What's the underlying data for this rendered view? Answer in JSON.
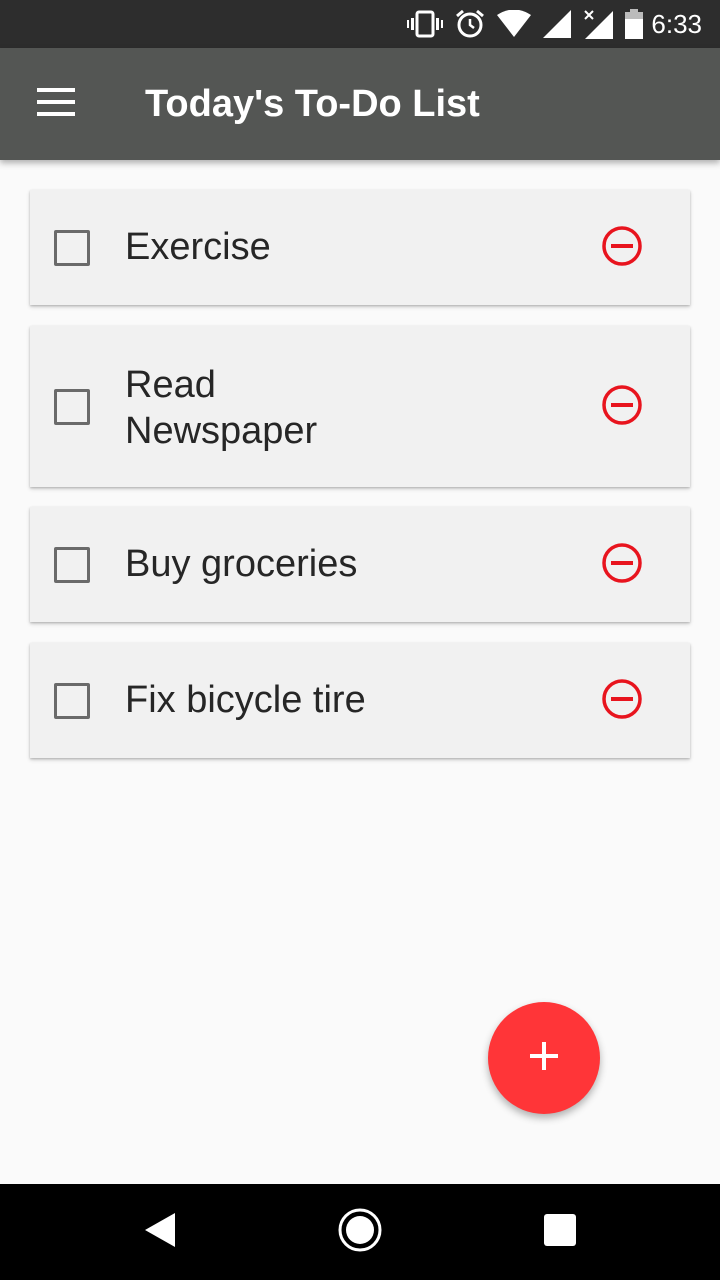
{
  "status_bar": {
    "time": "6:33",
    "icons": [
      "vibrate-icon",
      "alarm-icon",
      "wifi-icon",
      "cell-signal-icon",
      "cell-no-data-icon",
      "battery-icon"
    ]
  },
  "app_bar": {
    "title": "Today's To-Do List",
    "menu_icon": "hamburger-menu-icon"
  },
  "tasks": [
    {
      "label": "Exercise",
      "checked": false
    },
    {
      "label": "Read Newspaper",
      "checked": false
    },
    {
      "label": "Buy groceries",
      "checked": false
    },
    {
      "label": "Fix bicycle tire",
      "checked": false
    }
  ],
  "fab": {
    "icon": "plus-icon"
  },
  "nav_bar": {
    "icons": [
      "back-icon",
      "home-icon",
      "recents-icon"
    ]
  },
  "colors": {
    "app_bar": "#545654",
    "status_bar": "#2d2d2d",
    "accent": "#ff3538",
    "remove": "#e8141e"
  }
}
